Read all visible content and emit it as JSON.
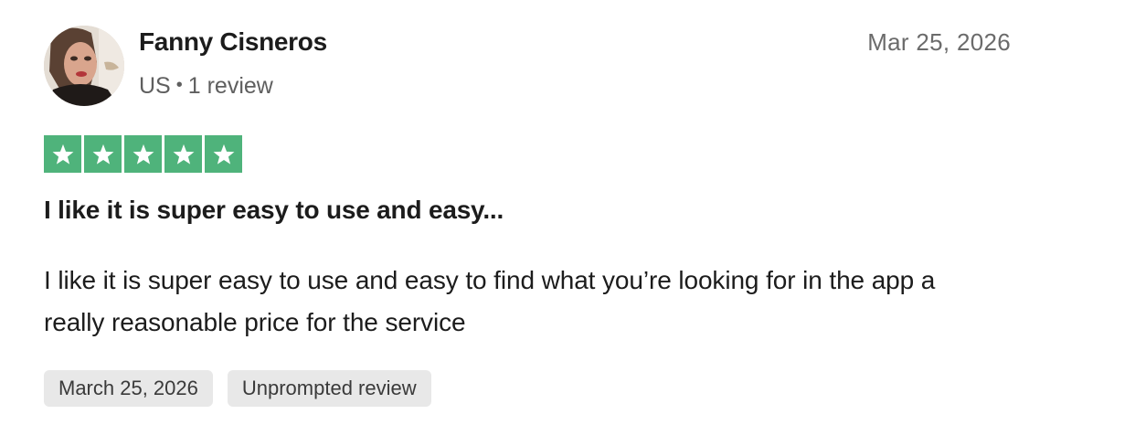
{
  "review": {
    "reviewer": {
      "name": "Fanny Cisneros",
      "country": "US",
      "separator": "•",
      "review_count": "1 review"
    },
    "date": "Mar 25, 2026",
    "rating": 5,
    "rating_max": 5,
    "star_color": "#4fb37b",
    "title": "I like it is super easy to use and easy...",
    "body": "I like it is super easy to use and easy to find what you’re looking for in the app a really reasonable price for the service",
    "tags": {
      "experience_date": "March 25, 2026",
      "review_type": "Unprompted review"
    }
  }
}
